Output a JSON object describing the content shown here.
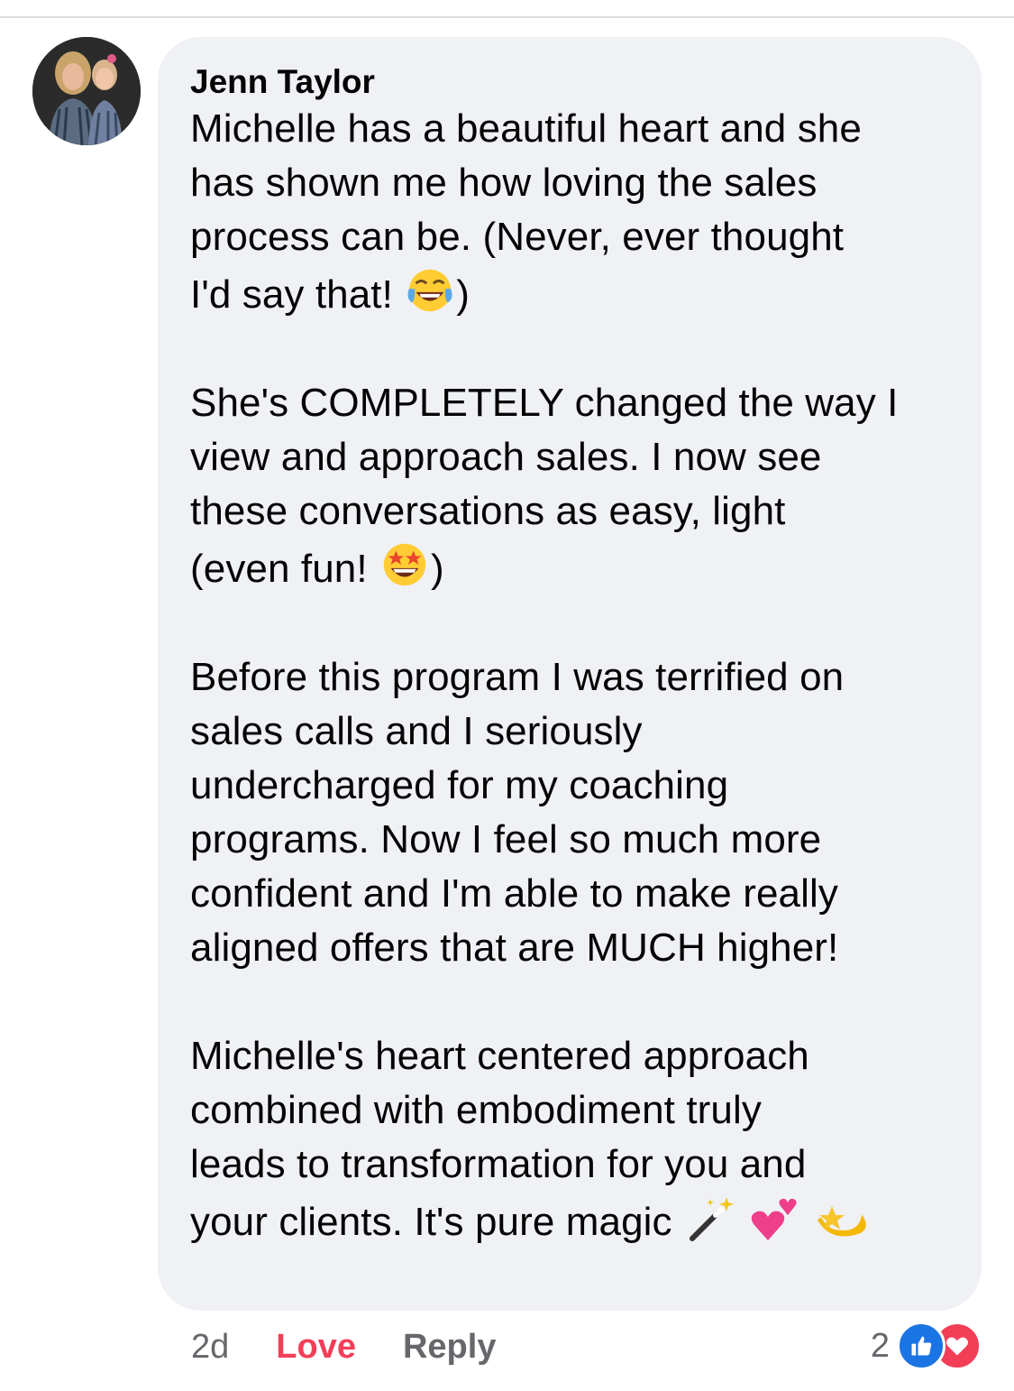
{
  "comment": {
    "author": "Jenn Taylor",
    "paragraphs": {
      "p1_lines": [
        "Michelle has a beautiful heart and she",
        "has shown me how loving the sales",
        "process can be. (Never, ever thought",
        "I'd say that!",
        ")"
      ],
      "p2_lines": [
        "She's COMPLETELY changed the way I",
        "view and approach sales. I now see",
        "these conversations as easy, light",
        "(even fun!",
        ")"
      ],
      "p3_lines": [
        "Before this program I was terrified on",
        "sales calls and I seriously",
        "undercharged for my coaching",
        "programs. Now I feel so much more",
        "confident and I'm able to make really",
        "aligned offers that are MUCH higher!"
      ],
      "p4_lines": [
        "Michelle's heart centered approach",
        "combined with embodiment truly",
        "leads to transformation for you and",
        "your clients. It's pure magic"
      ]
    },
    "emojis": [
      "face-with-tears-of-joy",
      "star-struck",
      "magic-wand",
      "two-hearts",
      "dizzy-star"
    ]
  },
  "actions": {
    "time": "2d",
    "love": "Love",
    "reply": "Reply"
  },
  "reactions": {
    "count": "2",
    "types": [
      "like",
      "love"
    ]
  },
  "colors": {
    "bubble": "#f0f1f5",
    "love": "#f33e58",
    "like": "#1b74e4",
    "secondary_text": "#65676b"
  }
}
